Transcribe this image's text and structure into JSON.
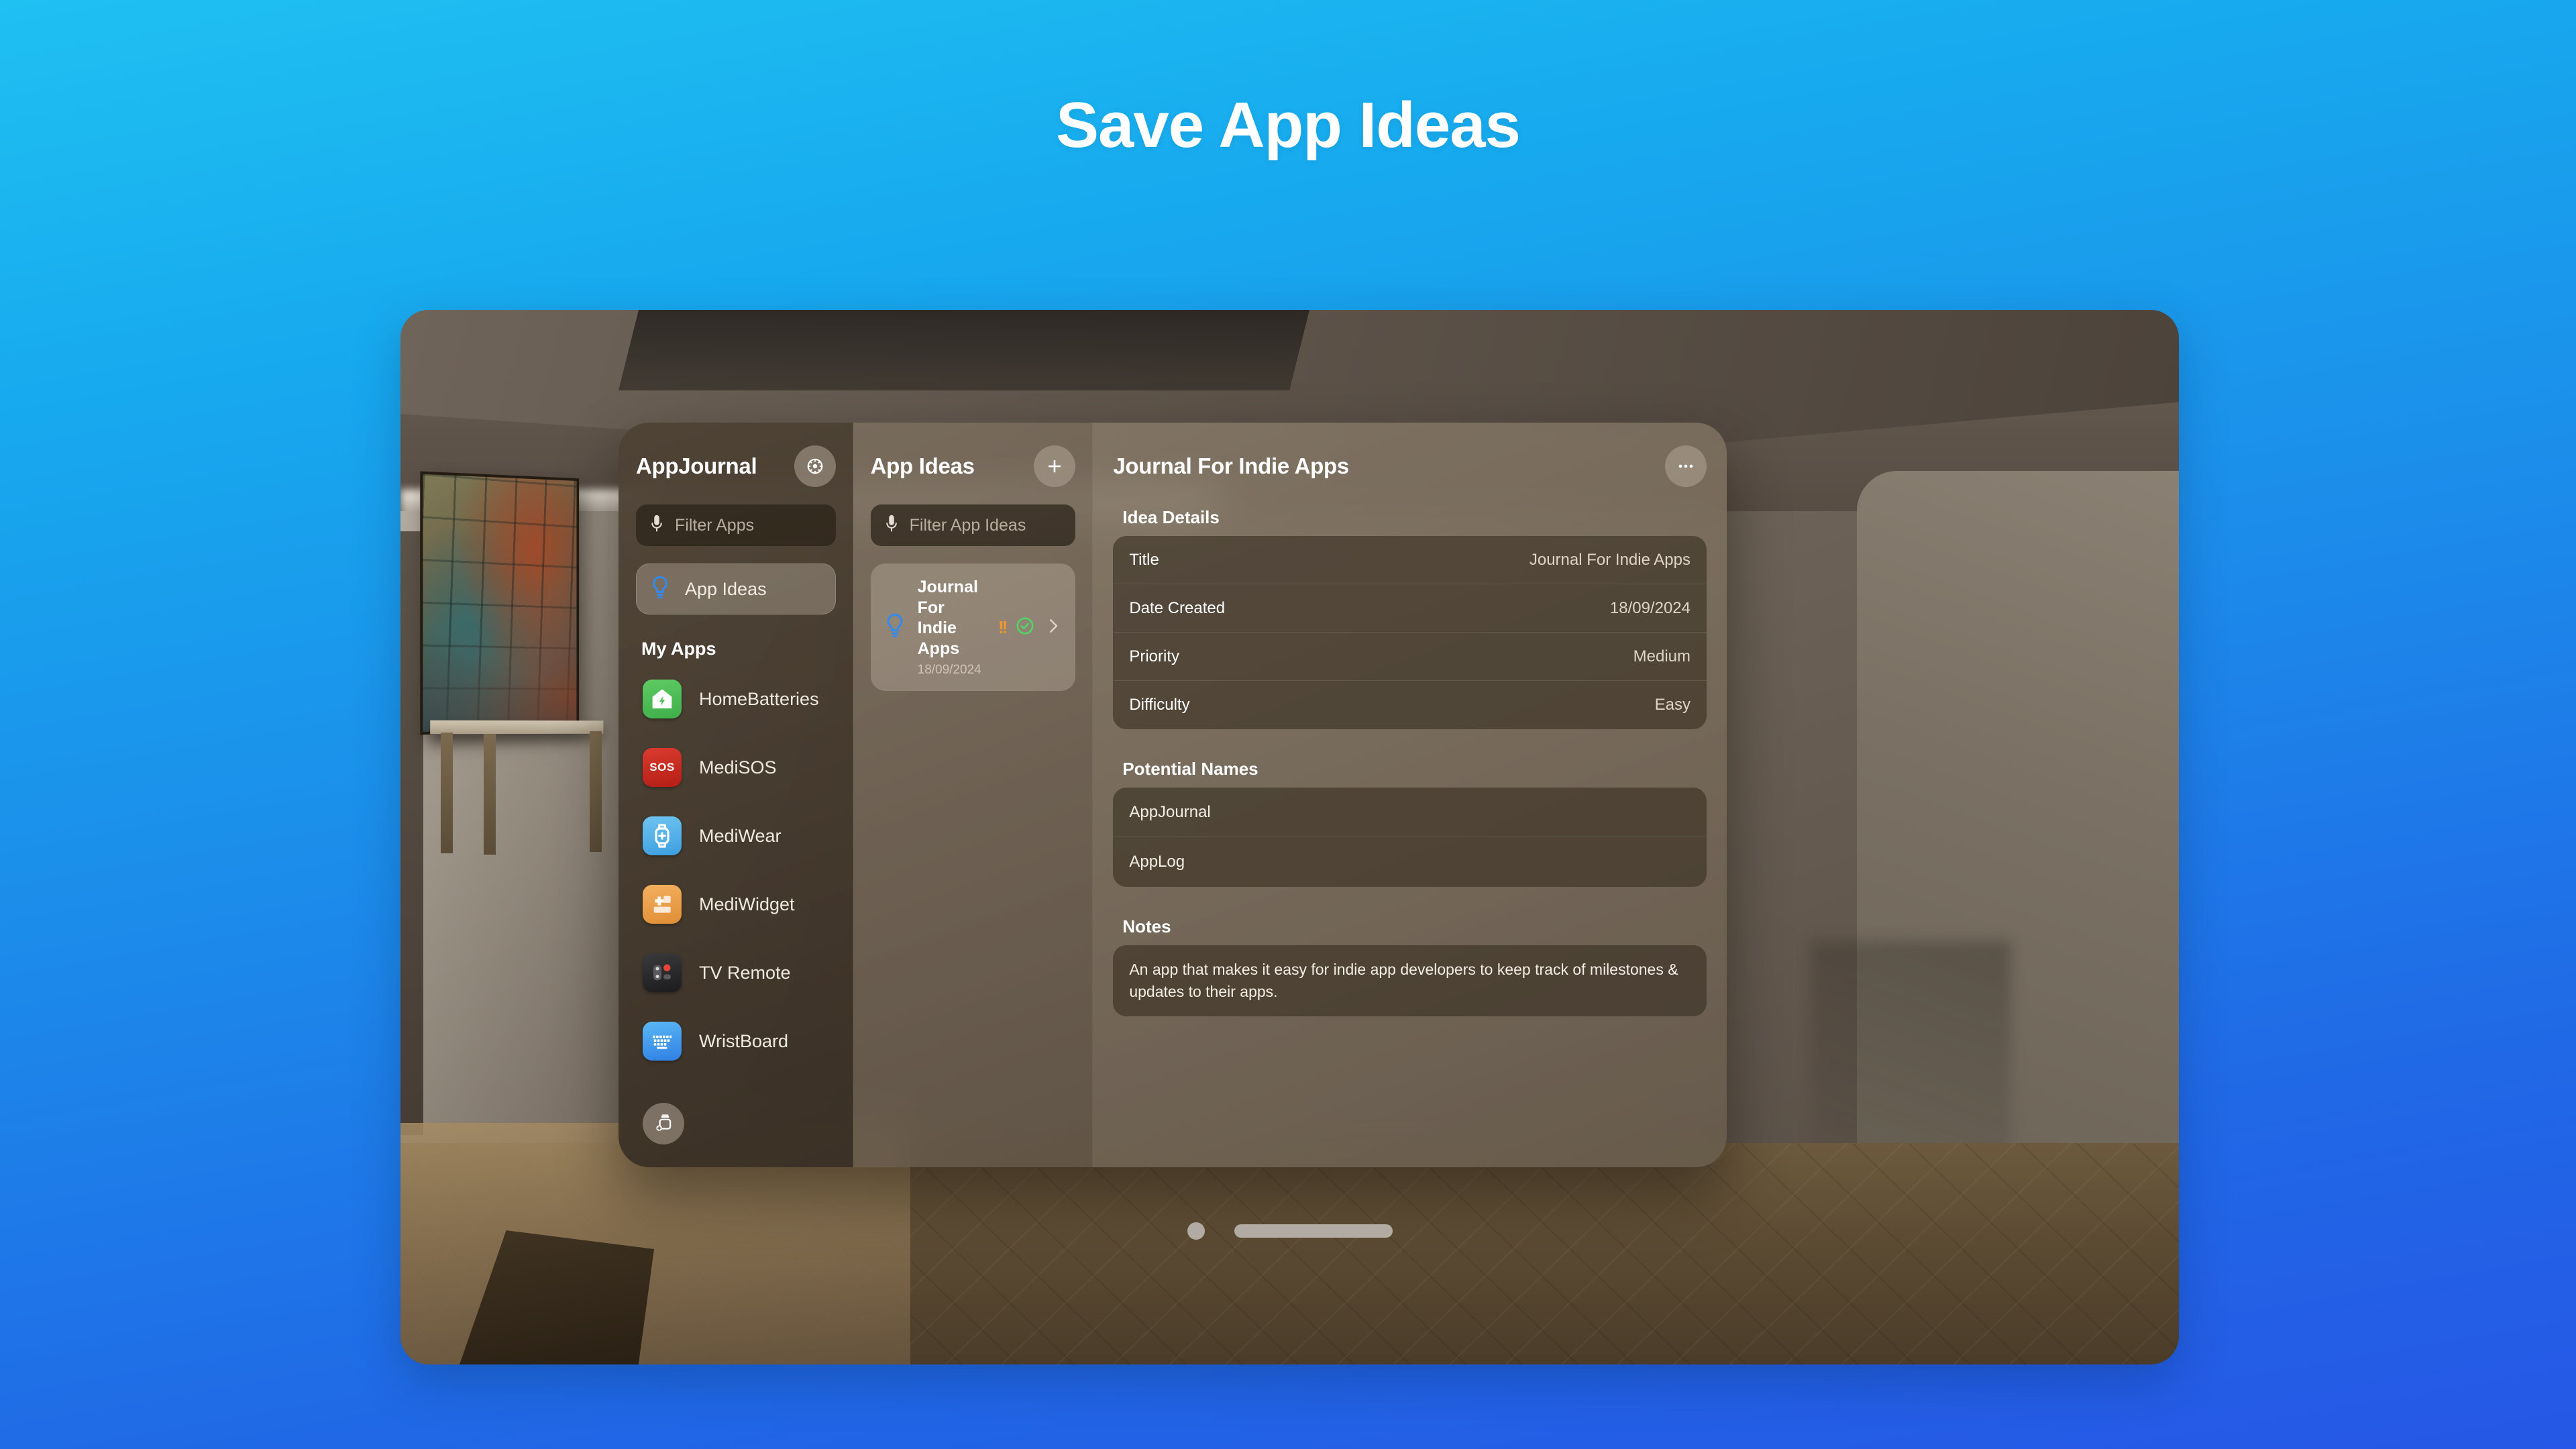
{
  "headline": "Save App Ideas",
  "sidebar": {
    "title": "AppJournal",
    "settings_icon": "gear-icon",
    "search": {
      "placeholder": "Filter Apps",
      "icon": "microphone-icon"
    },
    "nav": [
      {
        "label": "App Ideas",
        "icon": "lightbulb-icon",
        "selected": true
      }
    ],
    "section_label": "My Apps",
    "apps": [
      {
        "name": "HomeBatteries",
        "icon": "home-battery-icon",
        "color": "#4CC155"
      },
      {
        "name": "MediSOS",
        "icon": "sos-icon",
        "color": "#CC2A22"
      },
      {
        "name": "MediWear",
        "icon": "watch-plus-icon",
        "color": "#5AB5E8"
      },
      {
        "name": "MediWidget",
        "icon": "widget-plus-icon",
        "color": "#EFA249"
      },
      {
        "name": "TV Remote",
        "icon": "remote-icon",
        "color": "#2C2C2E"
      },
      {
        "name": "WristBoard",
        "icon": "keyboard-icon",
        "color": "#3F96EE"
      }
    ],
    "footer_button": {
      "icon": "new-window-icon",
      "label": ""
    }
  },
  "list": {
    "title": "App Ideas",
    "add_icon": "plus-icon",
    "search": {
      "placeholder": "Filter App Ideas",
      "icon": "microphone-icon"
    },
    "items": [
      {
        "title": "Journal For Indie Apps",
        "title_line1": "Journal For",
        "title_line2": "Indie Apps",
        "date": "18/09/2024",
        "icon": "lightbulb-icon",
        "priority_mark": "!!",
        "priority_color": "#F0982C",
        "status_icon": "check-circle-icon",
        "status_color": "#4CD964",
        "chevron": "chevron-right-icon",
        "selected": true
      }
    ]
  },
  "detail": {
    "title": "Journal For Indie Apps",
    "more_icon": "ellipsis-icon",
    "sections": [
      {
        "label": "Idea Details",
        "rows": [
          {
            "key": "Title",
            "value": "Journal For Indie Apps"
          },
          {
            "key": "Date Created",
            "value": "18/09/2024"
          },
          {
            "key": "Priority",
            "value": "Medium"
          },
          {
            "key": "Difficulty",
            "value": "Easy"
          }
        ]
      },
      {
        "label": "Potential Names",
        "names": [
          "AppJournal",
          "AppLog"
        ]
      },
      {
        "label": "Notes",
        "text": "An app that makes it easy for indie app developers to keep track of milestones & updates to their apps."
      }
    ]
  },
  "colors": {
    "background_top": "#1FC0F2",
    "background_bottom": "#2657E6",
    "accent_blue": "#2F8BF5",
    "priority_orange": "#F0982C",
    "status_green": "#4CD964"
  }
}
